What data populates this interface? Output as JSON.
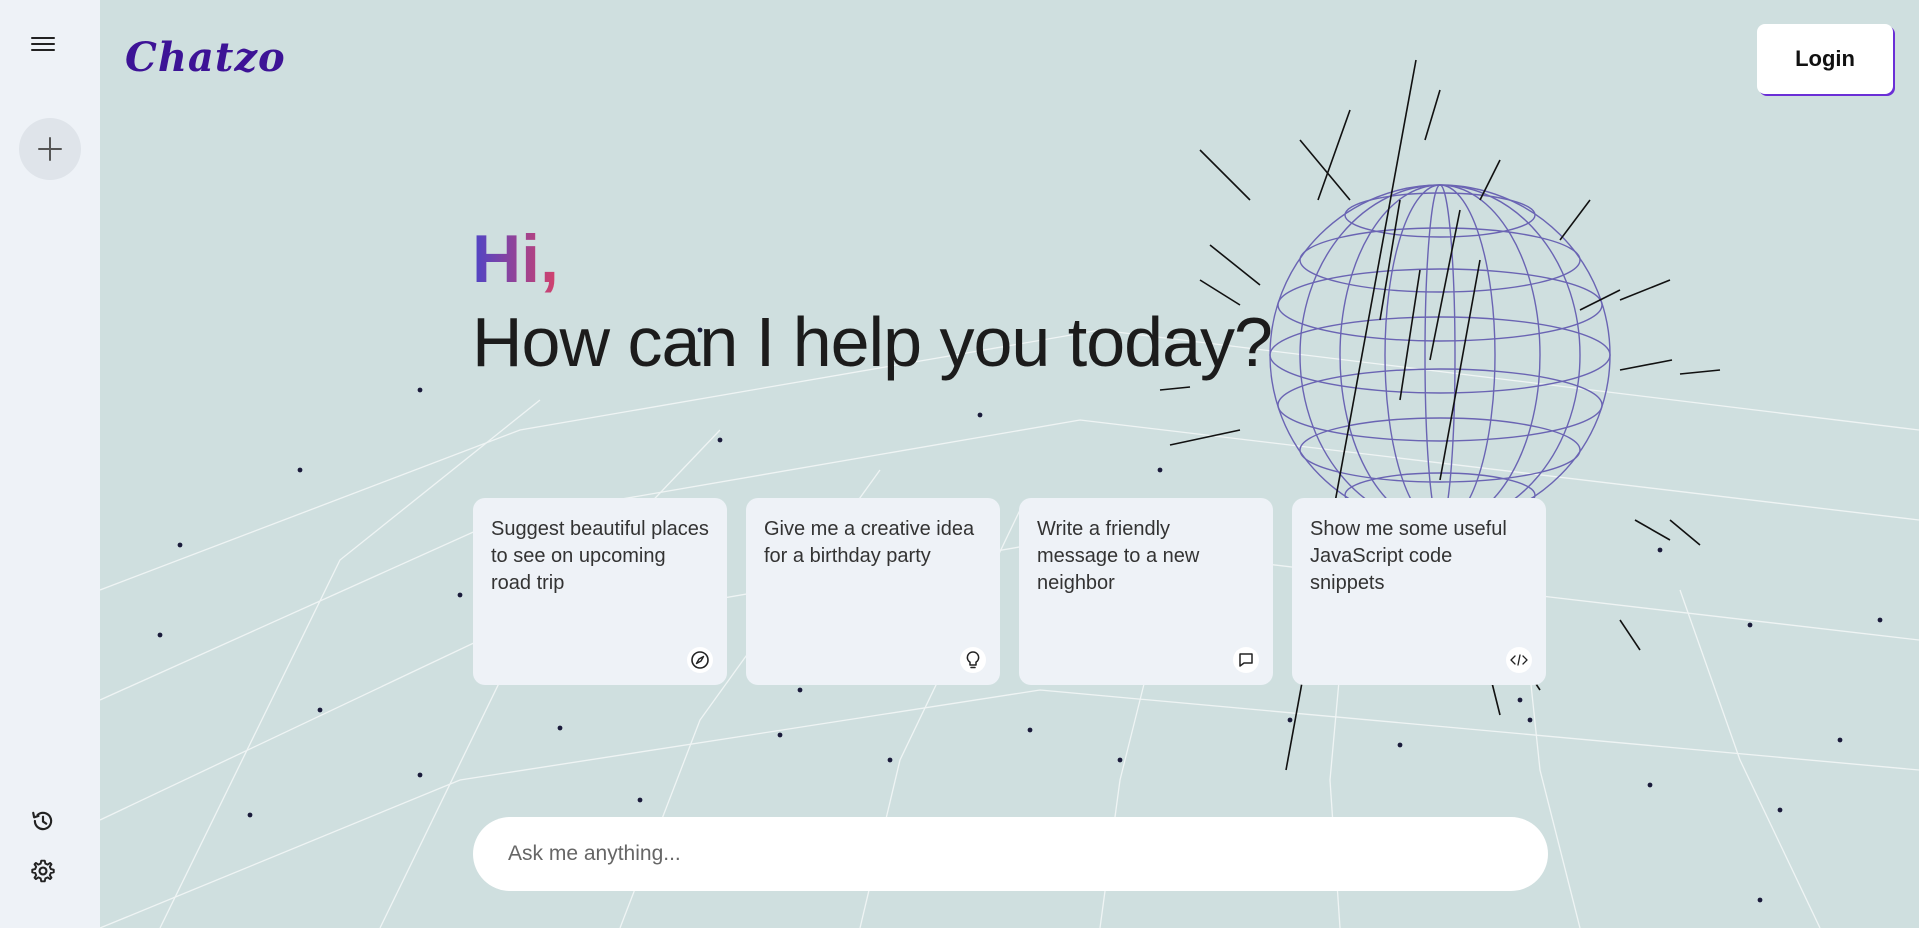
{
  "brand": {
    "name": "Chatzo",
    "color": "#3d1396"
  },
  "header": {
    "login_label": "Login"
  },
  "greeting": {
    "hi": "Hi,",
    "headline": "How can I help you today?"
  },
  "sidebar": {
    "icons": [
      "menu-icon",
      "plus-icon",
      "history-icon",
      "gear-icon"
    ]
  },
  "cards": [
    {
      "text": "Suggest beautiful places to see on upcoming road trip",
      "icon": "compass-icon"
    },
    {
      "text": "Give me a creative idea for a birthday party",
      "icon": "lightbulb-icon"
    },
    {
      "text": "Write a friendly message to a new neighbor",
      "icon": "message-icon"
    },
    {
      "text": "Show me some useful JavaScript code snippets",
      "icon": "code-icon"
    }
  ],
  "prompt": {
    "placeholder": "Ask me anything..."
  },
  "colors": {
    "background": "#cfdfdf",
    "sidebar": "#eef2f7",
    "accent": "#6b2fd6",
    "gradient_start": "#4d44c7",
    "gradient_end": "#d6426a"
  }
}
